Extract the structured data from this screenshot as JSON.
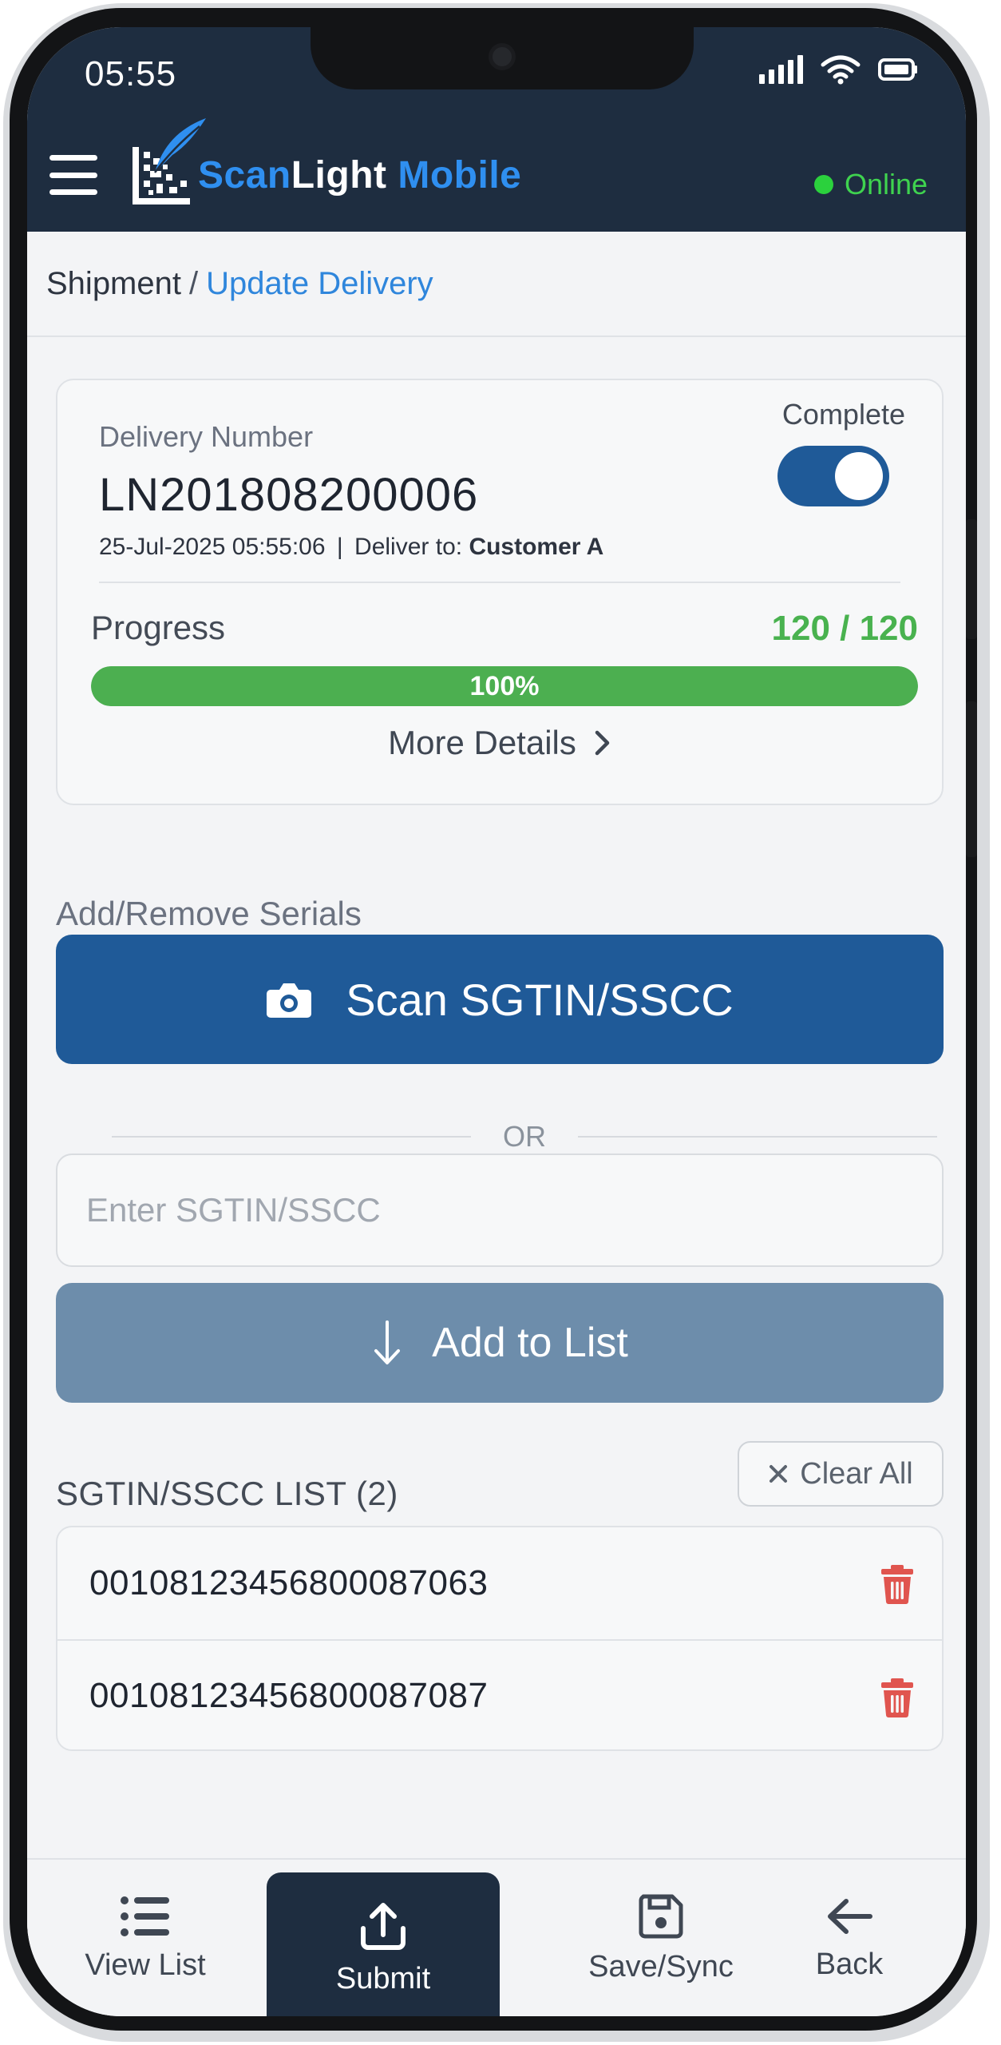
{
  "status_bar": {
    "time": "05:55"
  },
  "header": {
    "brand_part1": "Scan",
    "brand_part2": "Light",
    "brand_part3": " Mobile",
    "status": "Online"
  },
  "breadcrumb": {
    "parent": "Shipment",
    "separator": "/",
    "current": "Update Delivery"
  },
  "delivery": {
    "number_label": "Delivery Number",
    "number": "LN201808200006",
    "datetime": "25-Jul-2025 05:55:06",
    "deliver_to_label": "Deliver to:",
    "deliver_to": "Customer A",
    "complete_label": "Complete",
    "complete": true,
    "progress_label": "Progress",
    "progress_count": "120 / 120",
    "progress_fraction": 1.0,
    "progress_percent_text": "100%",
    "more_details": "More Details"
  },
  "serials": {
    "section_label": "Add/Remove Serials",
    "scan_button": "Scan SGTIN/SSCC",
    "or_text": "OR",
    "input_placeholder": "Enter SGTIN/SSCC",
    "input_value": "",
    "add_button": "Add to List",
    "list_title": "SGTIN/SSCC LIST (2)",
    "clear_all": "Clear All",
    "items": [
      "00108123456800087063",
      "00108123456800087087"
    ]
  },
  "bottom_nav": {
    "view_list": "View List",
    "submit": "Submit",
    "save_sync": "Save/Sync",
    "back": "Back"
  },
  "colors": {
    "header_bg": "#1e2d40",
    "primary": "#1f5a98",
    "accent_blue": "#2f8ff0",
    "success": "#4caf50",
    "online": "#2bd13d",
    "danger": "#e0554f",
    "disabled_button": "#6d8dab"
  }
}
